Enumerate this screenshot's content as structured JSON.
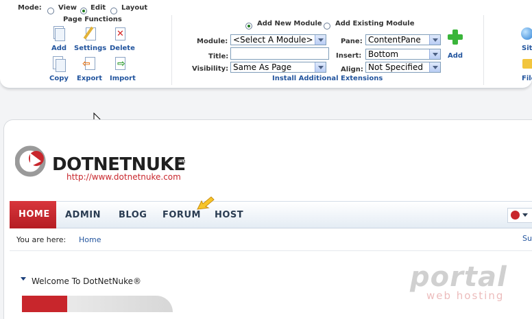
{
  "control_panel": {
    "mode_label": "Mode:",
    "modes": [
      "View",
      "Edit",
      "Layout"
    ],
    "page_functions": {
      "title": "Page Functions",
      "row1": [
        "Add",
        "Settings",
        "Delete"
      ],
      "row2": [
        "Copy",
        "Export",
        "Import"
      ]
    },
    "module": {
      "add_new": "Add New Module",
      "add_existing": "Add Existing Module",
      "module_label": "Module:",
      "module_value": "<Select A Module>",
      "title_label": "Title:",
      "title_value": "",
      "visibility_label": "Visibility:",
      "visibility_value": "Same As Page",
      "pane_label": "Pane:",
      "pane_value": "ContentPane",
      "insert_label": "Insert:",
      "insert_value": "Bottom",
      "align_label": "Align:",
      "align_value": "Not Specified",
      "add_label": "Add",
      "install_link": "Install Additional Extensions"
    },
    "right_cut": [
      "Sit",
      "File"
    ]
  },
  "site": {
    "logo_text": "DOTNETNUKE",
    "logo_tm": "TM",
    "logo_url": "http://www.dotnetnuke.com",
    "nav": [
      "HOME",
      "ADMIN",
      "BLOG",
      "FORUM",
      "HOST"
    ],
    "breadcrumb_label": "You are here:",
    "breadcrumb_item": "Home",
    "right_cut_link": "Su",
    "module_title": "Welcome To DotNetNuke®"
  },
  "watermark": {
    "line1": "portal",
    "line2": "web hosting"
  },
  "colors": {
    "accent_red": "#c8262c",
    "link_blue": "#23559e",
    "nav_text": "#2a3c52"
  }
}
